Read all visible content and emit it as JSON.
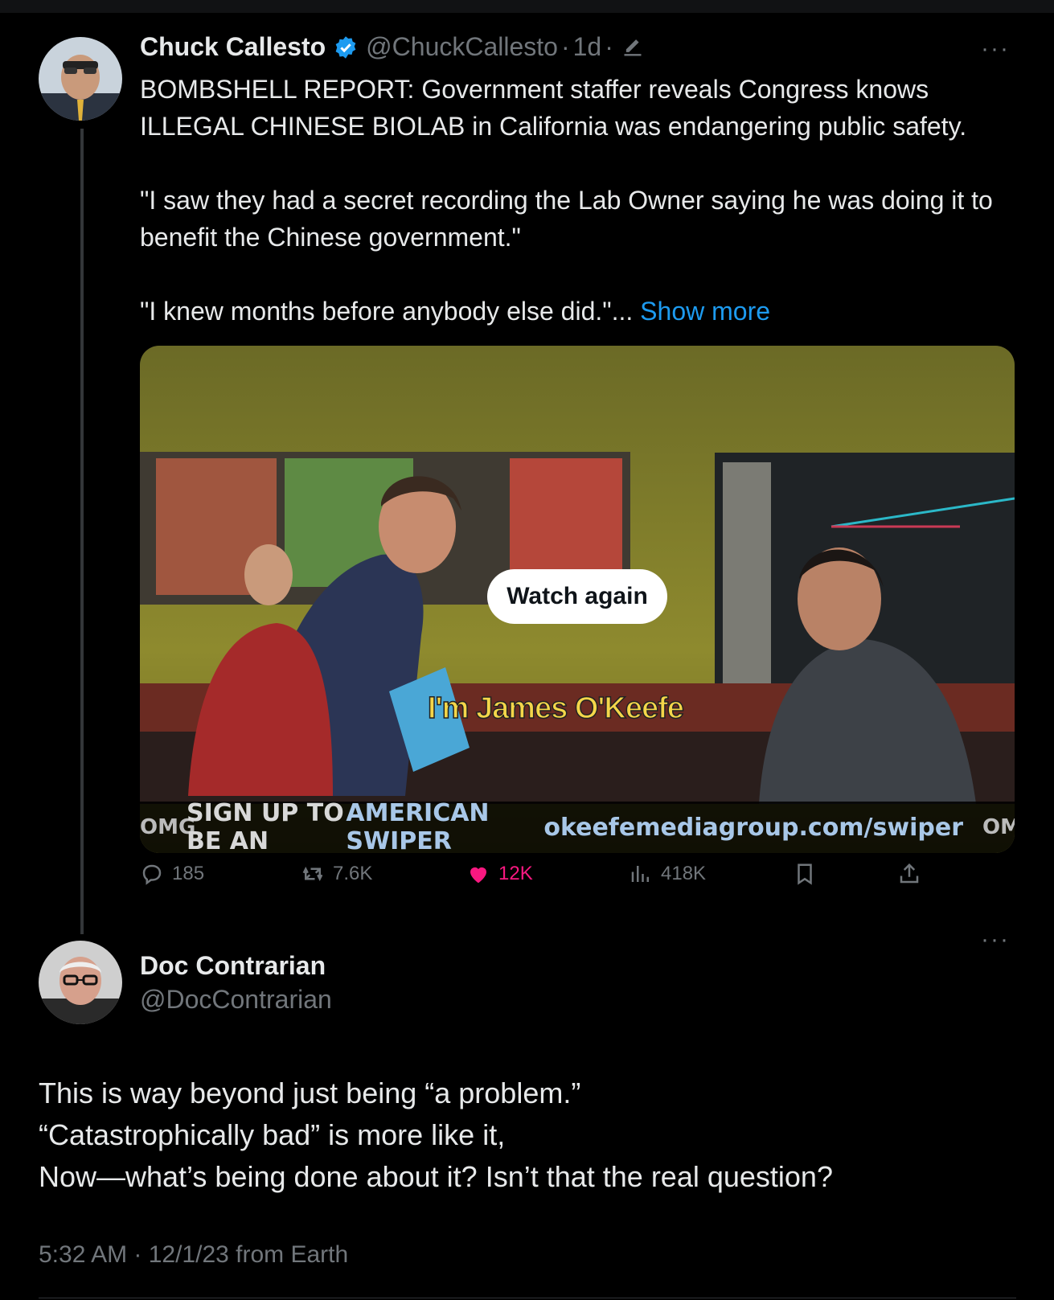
{
  "tweet": {
    "author_name": "Chuck Callesto",
    "handle": "@ChuckCallesto",
    "time": "1d",
    "separator": "·",
    "more": "···",
    "text": "BOMBSHELL REPORT: Government staffer reveals Congress knows ILLEGAL CHINESE BIOLAB in California was endangering public safety.\n\n\"I saw they had a secret recording the Lab Owner saying he was doing it to benefit the Chinese government.\"\n\n\"I knew months before anybody else did.\"... ",
    "show_more": "Show more",
    "media": {
      "watch_again": "Watch again",
      "caption": "I'm James O'Keefe",
      "banner_logo": "OMG",
      "banner_text_1": "SIGN UP TO BE AN ",
      "banner_text_2": "AMERICAN SWIPER",
      "banner_url": "okeefemediagroup.com/swiper"
    },
    "actions": {
      "replies": "185",
      "reposts": "7.6K",
      "likes": "12K",
      "views": "418K"
    },
    "colors": {
      "accent": "#1d9bf0",
      "like": "#f91880",
      "muted": "#71767b"
    }
  },
  "reply": {
    "author_name": "Doc Contrarian",
    "handle": "@DocContrarian",
    "more": "···",
    "text": "This is way beyond just being “a problem.”\n“Catastrophically bad” is more like it,\nNow—what’s being done about it? Isn’t that the real question?",
    "meta": "5:32 AM · 12/1/23 from Earth"
  }
}
